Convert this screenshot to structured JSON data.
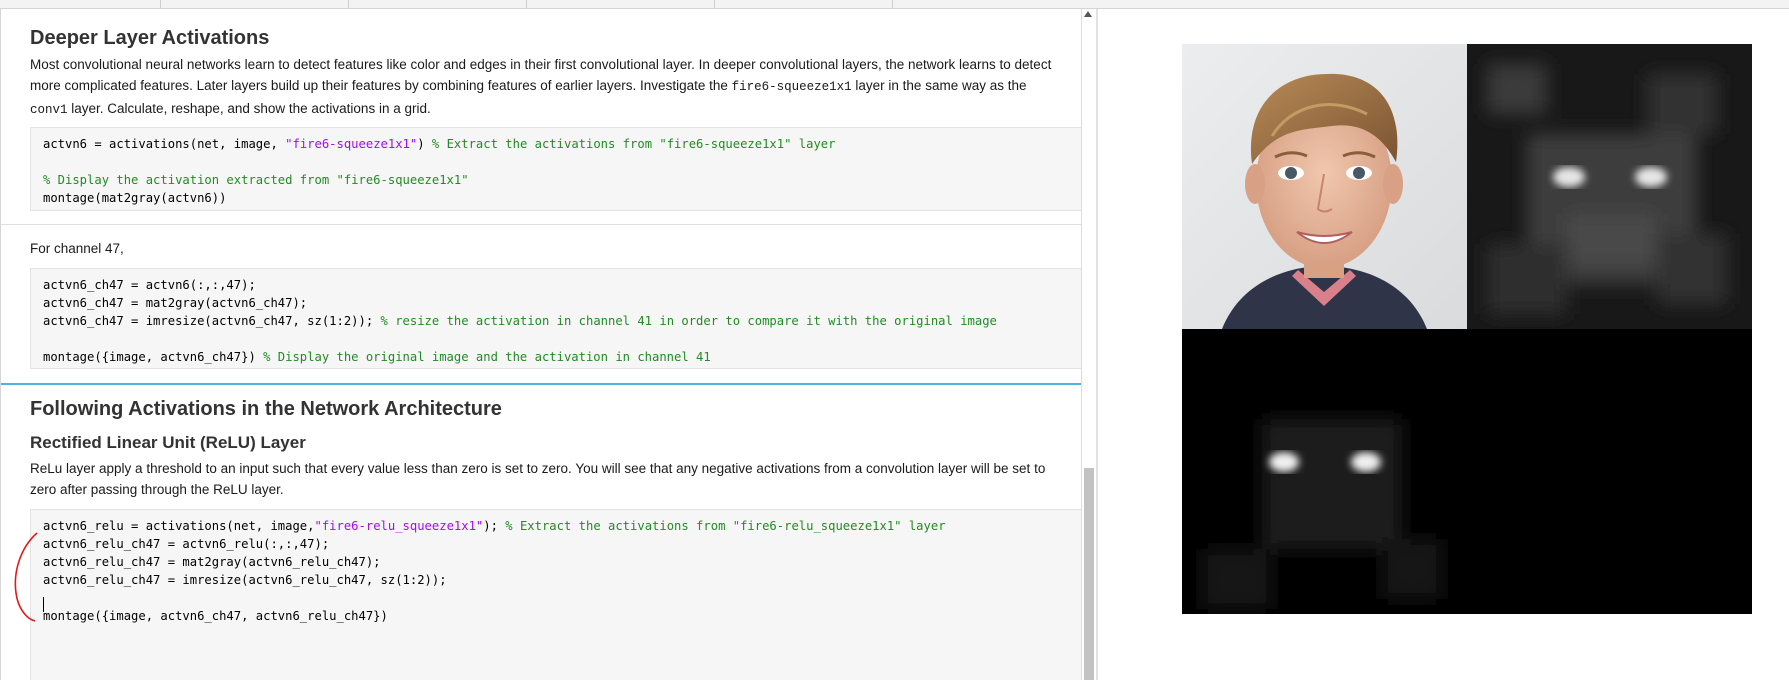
{
  "section1": {
    "heading": "Deeper Layer Activations",
    "para_parts": [
      "Most convolutional neural networks learn to detect features like color and edges in their first convolutional layer. In deeper convolutional layers, the network learns to detect more complicated features. Later layers build up their features by combining features of earlier layers. Investigate the ",
      "fire6-squeeze1x1",
      " layer in the same way as the ",
      "conv1",
      " layer. Calculate, reshape, and show the activations in a grid."
    ],
    "code": [
      {
        "pre": "actvn6 = activations(net, image, ",
        "str": "\"fire6-squeeze1x1\"",
        "post": ") ",
        "cmt": "% Extract the activations from \"fire6-squeeze1x1\" layer"
      },
      {
        "pre": "",
        "str": "",
        "post": "",
        "cmt": "% Display the activation extracted from \"fire6-squeeze1x1\""
      },
      {
        "pre": "montage(mat2gray(actvn6))",
        "str": "",
        "post": "",
        "cmt": ""
      }
    ]
  },
  "section2": {
    "para": "For channel 47,",
    "code": [
      {
        "pre": "actvn6_ch47 = actvn6(:,:,47);",
        "cmt": ""
      },
      {
        "pre": "actvn6_ch47 = mat2gray(actvn6_ch47);",
        "cmt": ""
      },
      {
        "pre": "actvn6_ch47 = imresize(actvn6_ch47, sz(1:2)); ",
        "cmt": "% resize the activation in channel 41 in order to compare it with the original image"
      },
      {
        "pre": "montage({image, actvn6_ch47}) ",
        "cmt": "% Display the original image and the activation in channel 41"
      }
    ]
  },
  "section3": {
    "heading": "Following Activations in the Network Architecture",
    "subheading": "Rectified Linear Unit (ReLU) Layer",
    "para": "ReLu layer apply a threshold to an input such that every value less than zero is set to zero. You will see that any negative activations from a convolution layer will be set to zero after passing through the ReLU layer.",
    "code": [
      {
        "pre": "actvn6_relu = activations(net, image,",
        "str": "\"fire6-relu_squeeze1x1\"",
        "post": "); ",
        "cmt": "% Extract the activations from \"fire6-relu_squeeze1x1\" layer"
      },
      {
        "pre": "actvn6_relu_ch47 = actvn6_relu(:,:,47);"
      },
      {
        "pre": "actvn6_relu_ch47 = mat2gray(actvn6_relu_ch47);"
      },
      {
        "pre": "actvn6_relu_ch47 = imresize(actvn6_relu_ch47, sz(1:2));"
      },
      {
        "pre": "montage({image, actvn6_ch47, actvn6_relu_ch47})"
      }
    ]
  },
  "colors": {
    "string": "#a709f5",
    "comment": "#228b22",
    "section_rule": "#4eb3e0",
    "annotation": "#e11b1b"
  }
}
